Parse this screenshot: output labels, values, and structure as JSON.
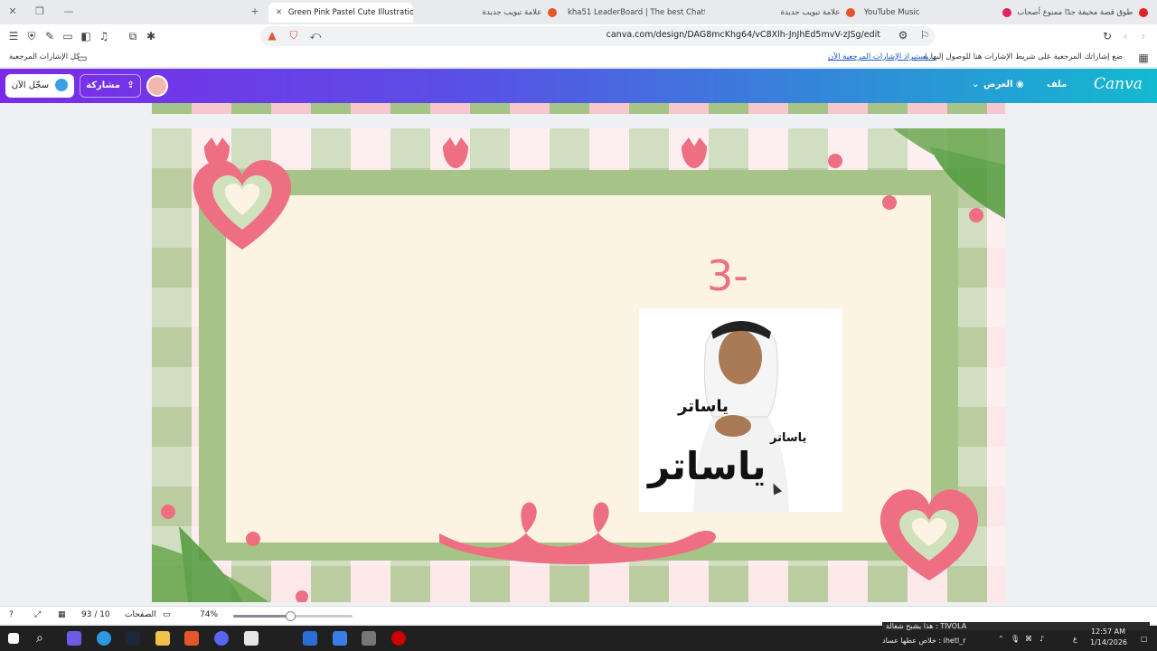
{
  "browser": {
    "tabs": [
      {
        "label": "Green Pink Pastel Cute Illustratio",
        "active": true
      },
      {
        "label": "علامة تبويب جديدة",
        "active": false
      },
      {
        "label": "kha51 LeaderBoard | The best Chatti",
        "active": false
      },
      {
        "label": "علامة تبويب جديدة",
        "active": false
      },
      {
        "label": "YouTube Music",
        "active": false
      },
      {
        "label": "طوق قصة مخيفة جدًا ممنوع أصحاب",
        "active": false
      }
    ],
    "url": "canva.com/design/DAG8mcKhg64/vC8Xlh-JnJhEd5mvV-zJSg/edit",
    "bookmarks_hint": "ضع إشاراتك المرجعية على شريط الإشارات هنا للوصول إليها بسرعة.",
    "bookmarks_import": "استيراد الإشارات المرجعية الآن...",
    "all_bookmarks": "كل الإشارات المرجعية"
  },
  "canva": {
    "logo": "Canva",
    "file_menu": "ملف",
    "view_menu": "العرض",
    "share_label": "مشاركة",
    "now_label": "سجّل الآن"
  },
  "slide": {
    "number_label": "3-",
    "image_captions": [
      "ياساتر",
      "ياساتر",
      "ياساتر"
    ]
  },
  "bottom": {
    "pages_label": "الصفحات",
    "page_counter": "93 / 10",
    "zoom_label": "74%",
    "zoom_value": 0.48
  },
  "taskbar": {
    "chat_line1": "هذا يشبح شغالة : TIVOLA",
    "chat_line2": "خلاص عطها عساد : ihetl_r",
    "lang": "ع",
    "time": "12:57 AM",
    "date": "1/14/2026"
  },
  "colors": {
    "green": "#a6c487",
    "pink": "#f6c7cc",
    "cream": "#fdf3e3",
    "heart": "#ef6f82",
    "brand_purple": "#7d2ae8",
    "brand_teal": "#13b9cf"
  }
}
